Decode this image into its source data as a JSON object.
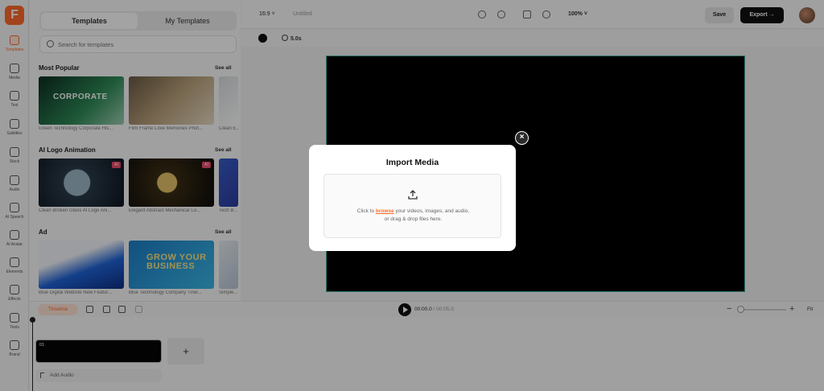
{
  "app": {
    "logo_letter": "F"
  },
  "rail": [
    {
      "label": "Templates",
      "icon": "templates-icon",
      "active": true
    },
    {
      "label": "Media",
      "icon": "media-icon"
    },
    {
      "label": "Text",
      "icon": "text-icon"
    },
    {
      "label": "Subtitles",
      "icon": "subtitles-icon"
    },
    {
      "label": "Stock",
      "icon": "stock-icon"
    },
    {
      "label": "Audio",
      "icon": "audio-icon"
    },
    {
      "label": "AI Speech",
      "icon": "ai-speech-icon"
    },
    {
      "label": "AI Avatar",
      "icon": "ai-avatar-icon"
    },
    {
      "label": "Elements",
      "icon": "elements-icon"
    },
    {
      "label": "Effects",
      "icon": "effects-icon"
    },
    {
      "label": "Tools",
      "icon": "tools-icon"
    },
    {
      "label": "Brand",
      "icon": "brand-icon"
    }
  ],
  "panel": {
    "tab_templates": "Templates",
    "tab_my_templates": "My Templates",
    "search_placeholder": "Search for templates",
    "see_all": "See all",
    "sections": [
      {
        "title": "Most Popular",
        "items": [
          {
            "caption": "Green Technology Corporate His...",
            "overlay": "CORPORATE"
          },
          {
            "caption": "Film Frame Love Memories Phot..."
          },
          {
            "caption": "Clean E..."
          }
        ]
      },
      {
        "title": "AI Logo Animation",
        "items": [
          {
            "caption": "Clean Broken Glass AI Logo Ani...",
            "badge": "AI"
          },
          {
            "caption": "Elegant Abstract Mechanical Lo...",
            "badge": "AI"
          },
          {
            "caption": "Tech B..."
          }
        ]
      },
      {
        "title": "Ad",
        "items": [
          {
            "caption": "Blue Digital Website New Featur..."
          },
          {
            "caption": "Blue Technology Company Tinel...",
            "overlay": "GROW YOUR BUSINESS"
          },
          {
            "caption": "Simple..."
          }
        ]
      }
    ]
  },
  "topbar": {
    "ratio": "16:9",
    "project_title": "Untitled",
    "zoom": "100%",
    "save_label": "Save",
    "export_label": "Export"
  },
  "subbar": {
    "duration": "5.0s"
  },
  "timeline": {
    "toggle_label": "Timeline",
    "current_time": "00:00.0",
    "total_time": "00:05.0",
    "fit_label": "Fit",
    "clip_number": "01",
    "add_audio_label": "Add Audio",
    "add_clip_label": "+"
  },
  "modal": {
    "title": "Import Media",
    "line1_pre": "Click to",
    "browse_label": "browse",
    "line1_post": "your videos, images, and audio,",
    "line2": "or drag & drop files here.",
    "close_label": "×"
  },
  "colors": {
    "accent": "#ff6a2b",
    "canvas_border": "#45b5a8",
    "overlay": "rgba(0,0,0,0.36)"
  }
}
